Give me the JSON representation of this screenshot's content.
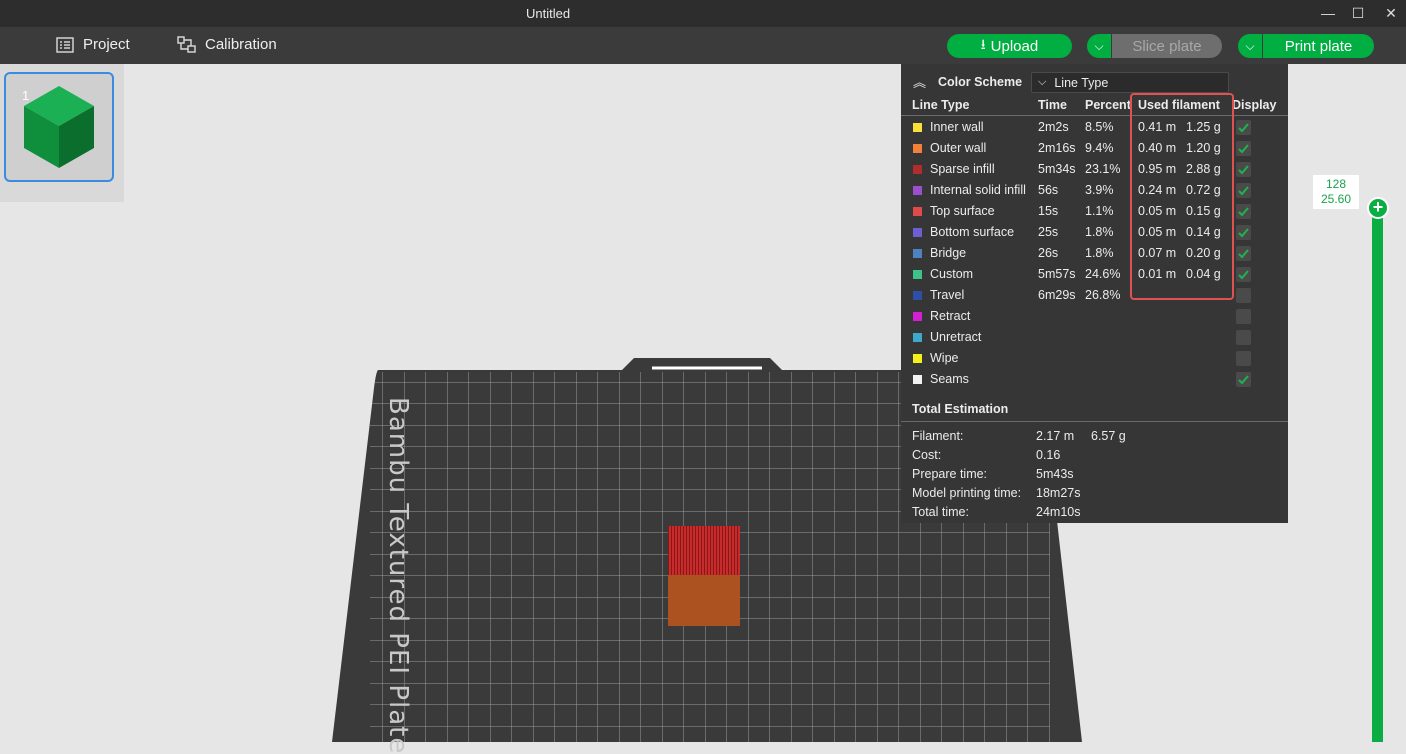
{
  "window": {
    "title": "Untitled",
    "minimize": "—",
    "maximize": "☐",
    "close": "✕"
  },
  "toolbar": {
    "project_label": "Project",
    "calibration_label": "Calibration",
    "upload_label": "Upload",
    "upload_icon": "⭳",
    "slice_label": "Slice plate",
    "print_label": "Print plate",
    "chevron": "⌵"
  },
  "plate": {
    "number": "1",
    "bed_name": "Bambu Textured PEI Plate"
  },
  "colors": {
    "accent": "#00ae42",
    "panel_bg": "#363636",
    "highlight": "#e05252"
  },
  "panel": {
    "color_scheme_label": "Color Scheme",
    "color_scheme_value": "Line Type",
    "headers": {
      "line_type": "Line Type",
      "time": "Time",
      "percent": "Percent",
      "used_filament": "Used filament",
      "display": "Display"
    },
    "rows": [
      {
        "name": "Inner wall",
        "color": "#f9e03d",
        "time": "2m2s",
        "percent": "8.5%",
        "length": "0.41 m",
        "weight": "1.25 g",
        "display": true
      },
      {
        "name": "Outer wall",
        "color": "#f0803a",
        "time": "2m16s",
        "percent": "9.4%",
        "length": "0.40 m",
        "weight": "1.20 g",
        "display": true
      },
      {
        "name": "Sparse infill",
        "color": "#b12c2c",
        "time": "5m34s",
        "percent": "23.1%",
        "length": "0.95 m",
        "weight": "2.88 g",
        "display": true
      },
      {
        "name": "Internal solid infill",
        "color": "#9b4fcf",
        "time": "56s",
        "percent": "3.9%",
        "length": "0.24 m",
        "weight": "0.72 g",
        "display": true
      },
      {
        "name": "Top surface",
        "color": "#e14a4a",
        "time": "15s",
        "percent": "1.1%",
        "length": "0.05 m",
        "weight": "0.15 g",
        "display": true
      },
      {
        "name": "Bottom surface",
        "color": "#6d5fd2",
        "time": "25s",
        "percent": "1.8%",
        "length": "0.05 m",
        "weight": "0.14 g",
        "display": true
      },
      {
        "name": "Bridge",
        "color": "#4e81c2",
        "time": "26s",
        "percent": "1.8%",
        "length": "0.07 m",
        "weight": "0.20 g",
        "display": true
      },
      {
        "name": "Custom",
        "color": "#3fc28a",
        "time": "5m57s",
        "percent": "24.6%",
        "length": "0.01 m",
        "weight": "0.04 g",
        "display": true
      },
      {
        "name": "Travel",
        "color": "#2f4ea8",
        "time": "6m29s",
        "percent": "26.8%",
        "length": "",
        "weight": "",
        "display": false
      },
      {
        "name": "Retract",
        "color": "#d21fd2",
        "time": "",
        "percent": "",
        "length": "",
        "weight": "",
        "display": false
      },
      {
        "name": "Unretract",
        "color": "#3ea8c8",
        "time": "",
        "percent": "",
        "length": "",
        "weight": "",
        "display": false
      },
      {
        "name": "Wipe",
        "color": "#f5ef1a",
        "time": "",
        "percent": "",
        "length": "",
        "weight": "",
        "display": false
      },
      {
        "name": "Seams",
        "color": "#f2f2f2",
        "time": "",
        "percent": "",
        "length": "",
        "weight": "",
        "display": true
      }
    ],
    "total": {
      "heading": "Total Estimation",
      "filament_label": "Filament:",
      "filament_length": "2.17 m",
      "filament_weight": "6.57 g",
      "cost_label": "Cost:",
      "cost_value": "0.16",
      "prepare_label": "Prepare time:",
      "prepare_value": "5m43s",
      "model_label": "Model printing time:",
      "model_value": "18m27s",
      "total_label": "Total time:",
      "total_value": "24m10s"
    }
  },
  "layer_slider": {
    "layer": "128",
    "height": "25.60",
    "handle": "+"
  }
}
